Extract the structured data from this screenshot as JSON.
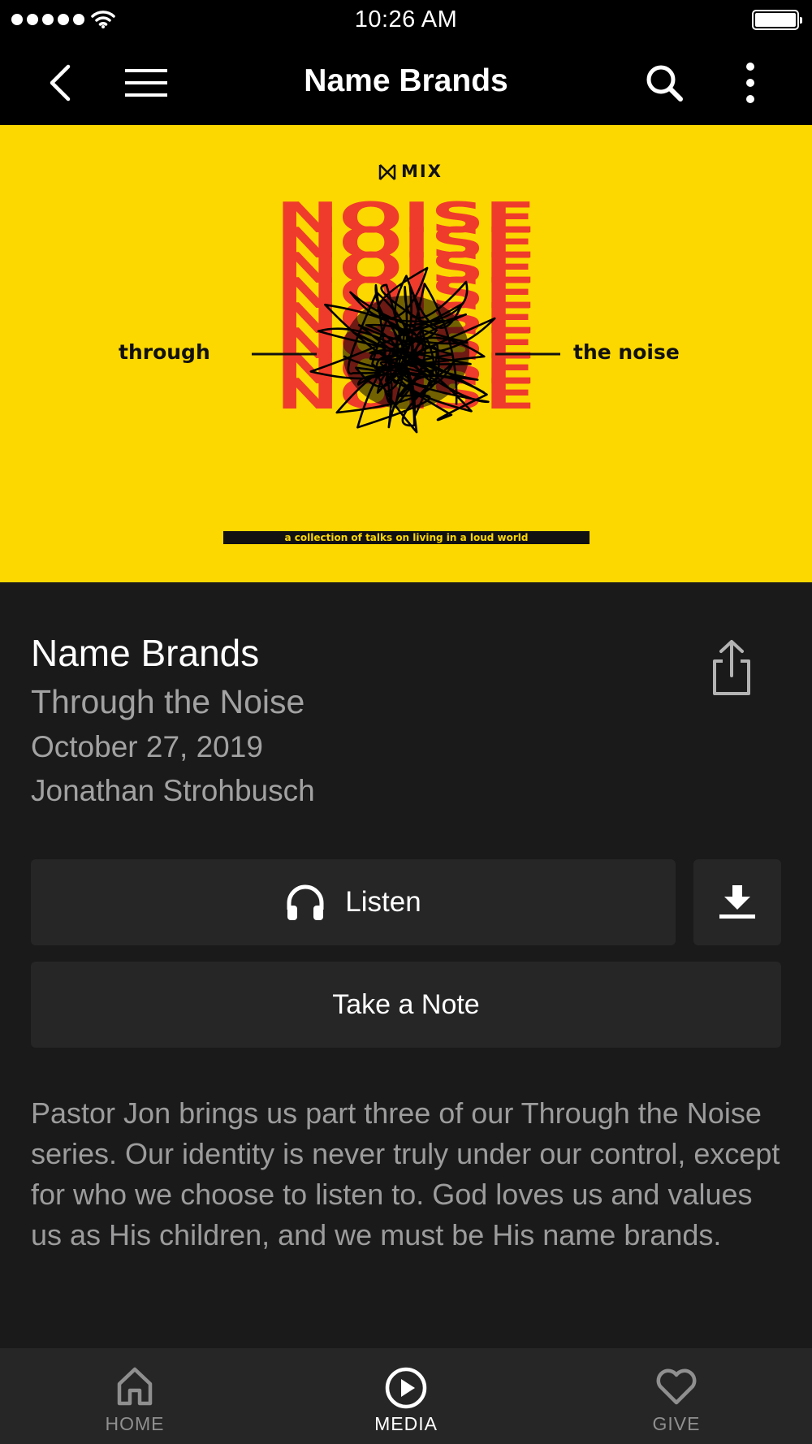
{
  "status_bar": {
    "time": "10:26 AM",
    "signal_icon": "signal-dots-icon",
    "wifi_icon": "wifi-icon",
    "battery_icon": "battery-icon",
    "battery_level": 1.0
  },
  "nav": {
    "title": "Name Brands",
    "back_icon": "chevron-left-icon",
    "menu_icon": "hamburger-menu-icon",
    "search_icon": "search-icon",
    "more_icon": "more-vertical-icon"
  },
  "cover": {
    "brand": "MIX",
    "word_left": "through",
    "word_right": "the noise",
    "repeated_word": "NOISE",
    "tagline": "a collection of talks on living in a loud world",
    "colors": {
      "background": "#fcd800",
      "repeated_word": "#ef3b2c",
      "scribble": "#000000"
    }
  },
  "episode": {
    "title": "Name Brands",
    "series": "Through the Noise",
    "date": "October 27, 2019",
    "speaker": "Jonathan Strohbusch",
    "share_icon": "share-icon"
  },
  "actions": {
    "listen_label": "Listen",
    "listen_icon": "headphones-icon",
    "download_icon": "download-icon",
    "note_label": "Take a Note"
  },
  "description": "Pastor Jon brings us part three of our Through the Noise series. Our identity is never truly under our control, except for who we choose to listen to. God loves us and values us as His children, and we must be His name brands.",
  "tabs": [
    {
      "label": "HOME",
      "icon": "home-icon",
      "active": false
    },
    {
      "label": "MEDIA",
      "icon": "play-circle-icon",
      "active": true
    },
    {
      "label": "GIVE",
      "icon": "heart-icon",
      "active": false
    }
  ]
}
